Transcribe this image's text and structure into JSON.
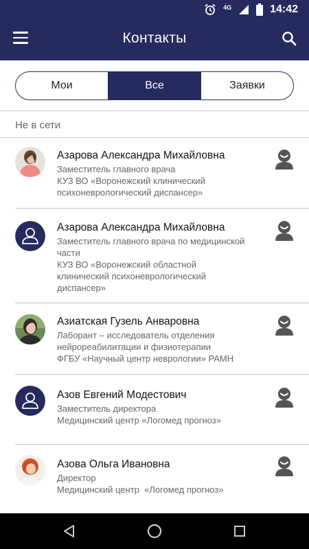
{
  "status_bar": {
    "time": "14:42",
    "network": "4G"
  },
  "header": {
    "title": "Контакты"
  },
  "tabs": [
    {
      "label": "Мои",
      "active": false
    },
    {
      "label": "Все",
      "active": true
    },
    {
      "label": "Заявки",
      "active": false
    }
  ],
  "section": {
    "label": "Не в сети"
  },
  "contacts": [
    {
      "name": "Азарова Александра Михайловна",
      "role_lines": [
        "Заместитель главного врача"
      ],
      "org_lines": [
        "КУЗ ВО «Воронежский клинический",
        "психоневрологический диспансер»"
      ],
      "avatar": "photo-woman-pink"
    },
    {
      "name": "Азарова Александра Михайловна",
      "role_lines": [
        "Заместитель главного врача по медицинской",
        "части"
      ],
      "org_lines": [
        "КУЗ ВО «Воронежский областной",
        "клинический психоневрологический",
        "диспансер»"
      ],
      "avatar": "placeholder-person"
    },
    {
      "name": "Азиатская Гузель Анваровна",
      "role_lines": [
        "Лаборант – исследователь отделения",
        "нейрореабилитации и физиотерапии"
      ],
      "org_lines": [
        "ФГБУ «Научный центр неврологии» РАМН"
      ],
      "avatar": "photo-woman-green"
    },
    {
      "name": "Азов Евгений Модестович",
      "role_lines": [
        "Заместитель директора"
      ],
      "org_lines": [
        "Медицинский центр «Логомед прогноз»"
      ],
      "avatar": "placeholder-person"
    },
    {
      "name": "Азова Ольга Ивановна",
      "role_lines": [
        "Директор"
      ],
      "org_lines": [
        "Медицинский центр  «Логомед прогноз»"
      ],
      "avatar": "photo-woman-red-hair"
    }
  ],
  "nav": {
    "back_icon": "back-triangle-icon",
    "home_icon": "home-circle-icon",
    "recents_icon": "recents-square-icon"
  },
  "colors": {
    "primary": "#262a5e",
    "status_icon": "#555555",
    "divider": "#c8c8c8"
  }
}
